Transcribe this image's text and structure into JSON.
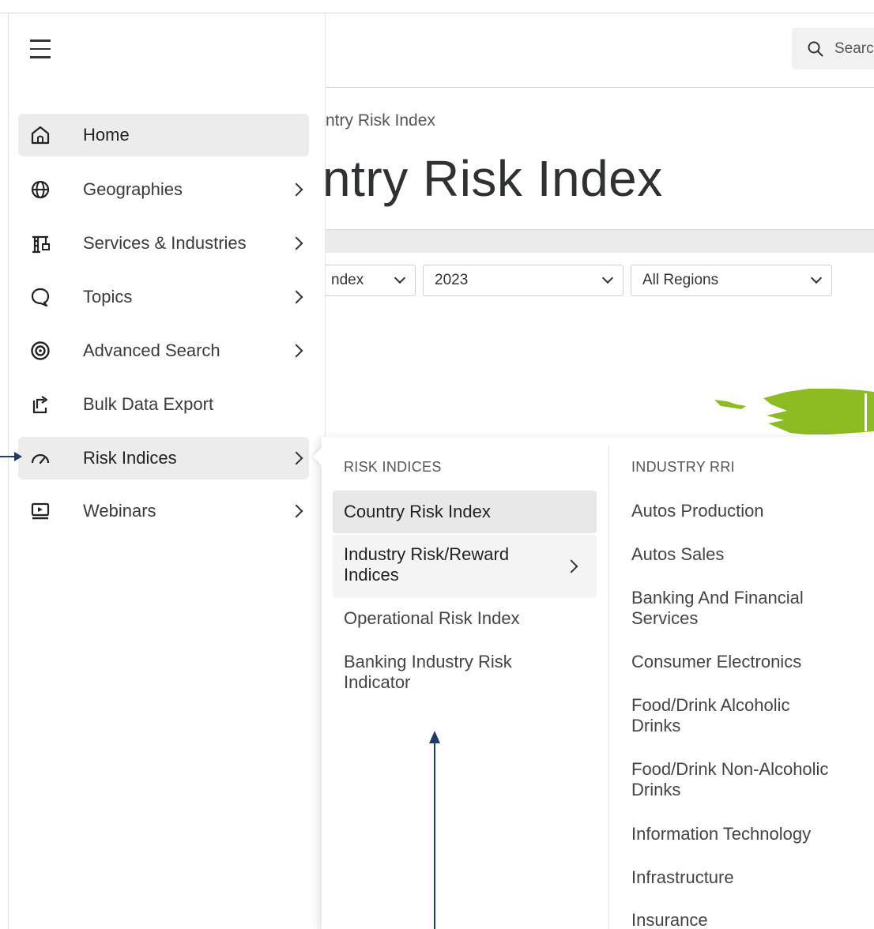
{
  "header": {
    "search_placeholder": "Searc",
    "breadcrumb": "ntry Risk Index",
    "page_title": "ntry Risk Index"
  },
  "filters": {
    "index_select": "ndex",
    "year_select": "2023",
    "region_select": "All Regions"
  },
  "sidebar": {
    "items": [
      {
        "label": "Home",
        "icon": "home-icon",
        "active": true
      },
      {
        "label": "Geographies",
        "icon": "globe-icon"
      },
      {
        "label": "Services & Industries",
        "icon": "crane-icon"
      },
      {
        "label": "Topics",
        "icon": "speech-bubble-icon"
      },
      {
        "label": "Advanced Search",
        "icon": "target-icon"
      },
      {
        "label": "Bulk Data Export",
        "icon": "export-icon"
      },
      {
        "label": "Risk Indices",
        "icon": "gauge-icon",
        "hovered": true
      },
      {
        "label": "Webinars",
        "icon": "monitor-icon"
      }
    ]
  },
  "flyout": {
    "risk_indices_heading": "RISK INDICES",
    "risk_indices": [
      {
        "label": "Country Risk Index",
        "selected": true
      },
      {
        "label": "Industry Risk/Reward Indices",
        "has_submenu": true
      },
      {
        "label": "Operational Risk Index"
      },
      {
        "label": "Banking Industry Risk Indicator"
      }
    ],
    "industry_heading": "INDUSTRY RRI",
    "industry_items": [
      "Autos Production",
      "Autos Sales",
      "Banking And Financial Services",
      "Consumer Electronics",
      "Food/Drink Alcoholic Drinks",
      "Food/Drink Non-Alcoholic Drinks",
      "Information Technology",
      "Infrastructure",
      "Insurance"
    ]
  },
  "colors": {
    "annotation_arrow": "#1f3b66",
    "map_green": "#8dbb22",
    "active_bg": "#ececec"
  }
}
